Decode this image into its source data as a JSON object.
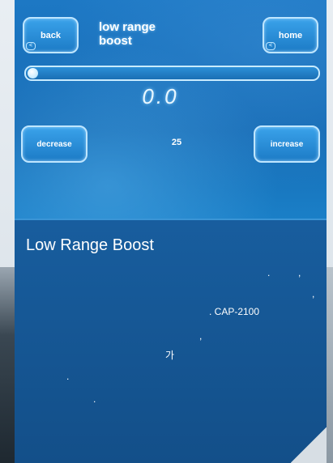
{
  "screen": {
    "back_label": "back",
    "home_label": "home",
    "title_line1": "low range",
    "title_line2": "boost",
    "value": "0.0",
    "decrease_label": "decrease",
    "increase_label": "increase",
    "step": "25",
    "slider_level": 0.0
  },
  "page": {
    "title": "Low Range Boost",
    "desc_fragments": [
      ".",
      ",",
      ",",
      ". CAP-2100",
      ",",
      "가",
      ".",
      "."
    ]
  },
  "colors": {
    "panel_blue": "#185e9f",
    "screen_blue": "#1d78c4",
    "button_glow": "#bfe6ff"
  },
  "icons": {
    "back_mini": "left-arrow-icon",
    "home_mini": "left-arrow-icon"
  }
}
